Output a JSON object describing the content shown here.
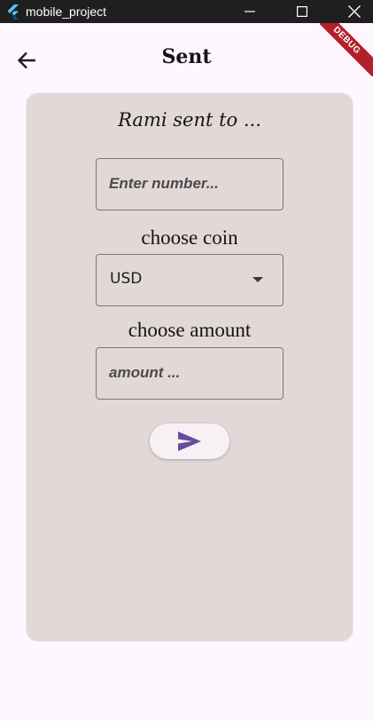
{
  "window": {
    "title": "mobile_project",
    "app_icon": "flutter-icon",
    "controls": [
      "minimize-icon",
      "maximize-icon",
      "close-icon"
    ]
  },
  "appbar": {
    "back_icon": "arrow-left-icon",
    "title": "Sent",
    "debug_label": "DEBUG"
  },
  "form": {
    "heading": "Rami sent to ...",
    "number_placeholder": "Enter number...",
    "coin_label": "choose coin",
    "coin_selected": "USD",
    "amount_label": "choose amount",
    "amount_placeholder": "amount ...",
    "send_icon": "send-icon"
  },
  "colors": {
    "background": "#fff7ff",
    "card": "#e2d8d8",
    "accent": "#6a4aa0",
    "debug_banner": "#b3202b"
  }
}
